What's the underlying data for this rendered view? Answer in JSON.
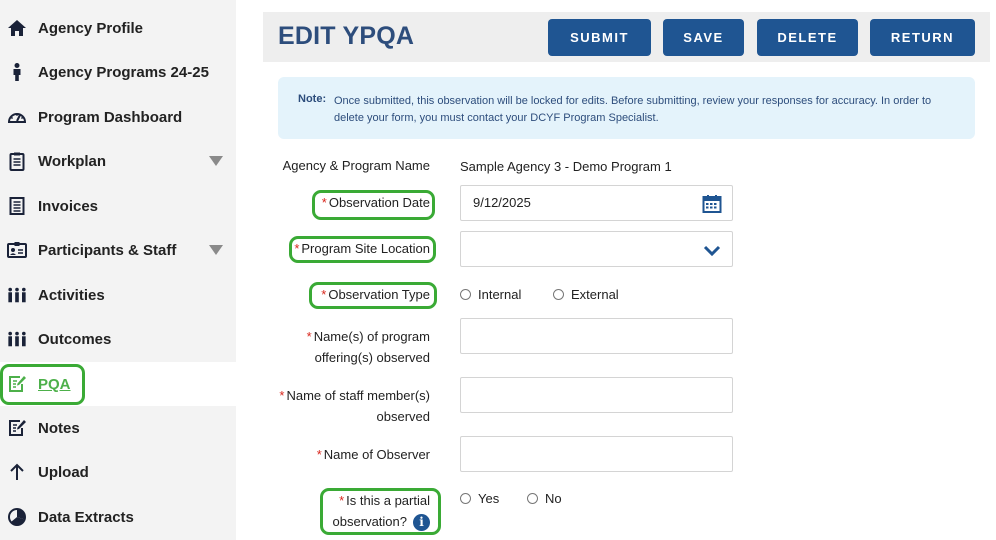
{
  "sidebar": {
    "items": [
      {
        "label": "Agency Profile",
        "icon": "home-icon"
      },
      {
        "label": "Agency Programs 24-25",
        "icon": "person-icon"
      },
      {
        "label": "Program Dashboard",
        "icon": "gauge-icon"
      },
      {
        "label": "Workplan",
        "icon": "clipboard-icon",
        "expandable": true
      },
      {
        "label": "Invoices",
        "icon": "document-icon"
      },
      {
        "label": "Participants & Staff",
        "icon": "id-card-icon",
        "expandable": true
      },
      {
        "label": "Activities",
        "icon": "group-icon"
      },
      {
        "label": "Outcomes",
        "icon": "group-icon"
      },
      {
        "label": "PQA",
        "icon": "edit-icon",
        "active": true
      },
      {
        "label": "Notes",
        "icon": "edit-icon"
      },
      {
        "label": "Upload",
        "icon": "arrow-up-icon"
      },
      {
        "label": "Data Extracts",
        "icon": "pie-chart-icon"
      }
    ]
  },
  "header": {
    "title": "EDIT YPQA",
    "buttons": {
      "submit": "SUBMIT",
      "save": "SAVE",
      "delete": "DELETE",
      "return": "RETURN"
    }
  },
  "note": {
    "label": "Note:",
    "text": "Once submitted, this observation will be locked for edits. Before submitting, review your responses for accuracy. In order to delete your form, you must contact your DCYF Program Specialist."
  },
  "form": {
    "agency_program_label": "Agency & Program Name",
    "agency_program_value": "Sample Agency 3 - Demo Program 1",
    "required_marker": "*",
    "observation_date_label": "Observation Date",
    "observation_date_value": "9/12/2025",
    "site_location_label": "Program Site Location",
    "site_location_value": "",
    "observation_type_label": "Observation Type",
    "observation_type_options": [
      "Internal",
      "External"
    ],
    "offering_label_1": "Name(s) of program",
    "offering_label_2": "offering(s) observed",
    "offering_value": "",
    "staff_label_1": "Name of staff member(s)",
    "staff_label_2": "observed",
    "staff_value": "",
    "observer_label": "Name of Observer",
    "observer_value": "",
    "partial_label_1": "Is this a partial",
    "partial_label_2": "observation?",
    "partial_info": "i",
    "partial_options": [
      "Yes",
      "No"
    ]
  },
  "colors": {
    "primary": "#1f5592",
    "title": "#2d4d7c",
    "highlight": "#3aaa35",
    "active_link": "#4db04a",
    "required": "#d9261c",
    "note_bg": "#e4f3fb"
  }
}
